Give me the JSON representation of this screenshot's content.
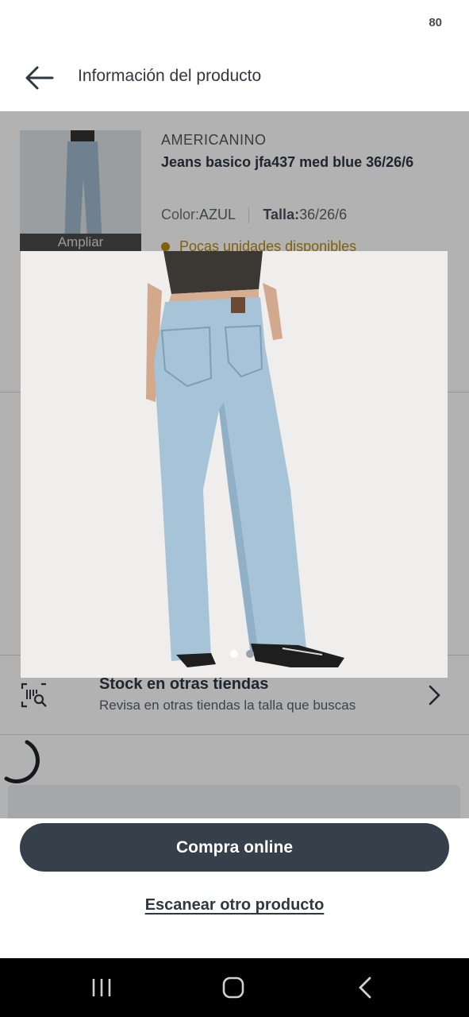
{
  "status": {
    "battery": "80"
  },
  "appbar": {
    "title": "Información del producto",
    "back_icon": "arrow-left-icon"
  },
  "product": {
    "brand": "AMERICANINO",
    "name": "Jeans basico jfa437 med blue 36/26/6",
    "color_label": "Color:",
    "color_value": "AZUL",
    "size_label": "Talla:",
    "size_value": "36/26/6",
    "availability": "Pocas unidades disponibles",
    "zoom_label": "Ampliar"
  },
  "stock": {
    "title": "Stock en otras tiendas",
    "subtitle": "Revisa en otras tiendas la talla que buscas",
    "icon": "store-search-icon"
  },
  "colors": {
    "primary": "#36404b",
    "warning": "#b88a10",
    "text": "#2f3742"
  },
  "actions": {
    "buy_online": "Compra online",
    "scan_again": "Escanear otro producto"
  },
  "image_viewer": {
    "page_count": 2,
    "active_page": 1
  }
}
